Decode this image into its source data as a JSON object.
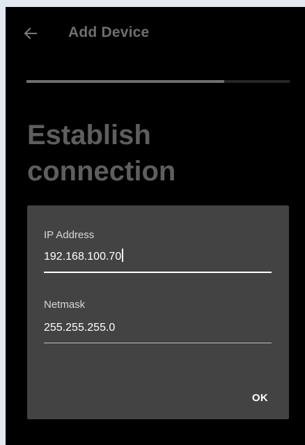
{
  "app_bar": {
    "title": "Add Device",
    "back_icon": "arrow-left-icon"
  },
  "progress": {
    "value": 0.75
  },
  "page": {
    "heading": "Establish connection"
  },
  "dialog": {
    "ip_field": {
      "label": "IP Address",
      "value": "192.168.100.70",
      "focused": true
    },
    "netmask_field": {
      "label": "Netmask",
      "value": "255.255.255.0"
    },
    "ok_label": "OK"
  },
  "colors": {
    "background": "#000000",
    "dialog": "#434343",
    "dim_text": "#6f6f6f",
    "accent": "#ffffff"
  }
}
